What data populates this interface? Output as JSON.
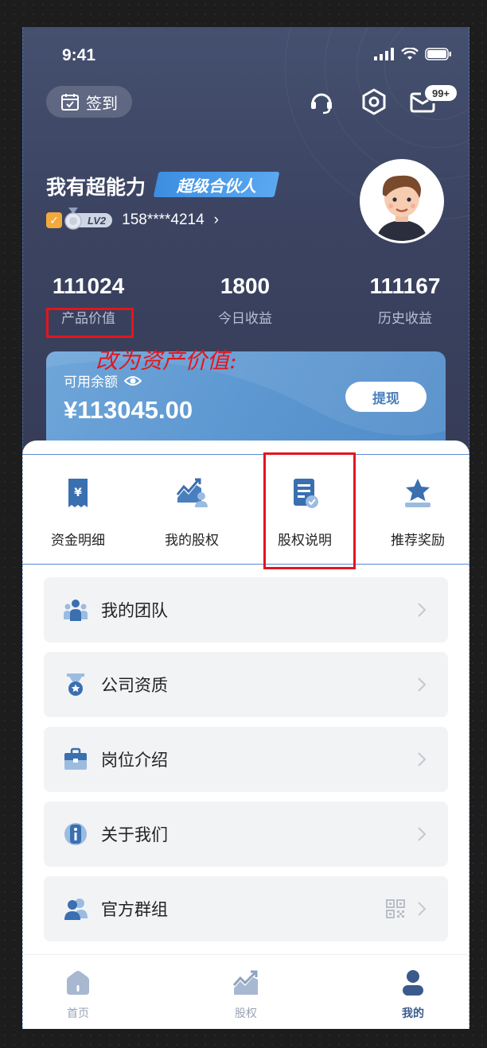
{
  "status": {
    "time": "9:41"
  },
  "header": {
    "checkin_label": "签到",
    "message_badge": "99+",
    "username": "我有超能力",
    "partner_badge": "超级合伙人",
    "level": "LV2",
    "phone": "158****4214",
    "phone_chevron": "›"
  },
  "stats": [
    {
      "value": "111024",
      "label": "产品价值"
    },
    {
      "value": "1800",
      "label": "今日收益"
    },
    {
      "value": "111167",
      "label": "历史收益"
    }
  ],
  "annotation": {
    "text": "改为资产价值:",
    "color": "#e4151c"
  },
  "balance": {
    "label": "可用余额",
    "amount": "¥113045.00",
    "withdraw_label": "提现"
  },
  "quick_actions": [
    {
      "label": "资金明细",
      "icon": "receipt-yen-icon"
    },
    {
      "label": "我的股权",
      "icon": "equity-chart-icon"
    },
    {
      "label": "股权说明",
      "icon": "document-check-icon"
    },
    {
      "label": "推荐奖励",
      "icon": "award-star-icon"
    }
  ],
  "menu": [
    {
      "label": "我的团队",
      "icon": "team-icon"
    },
    {
      "label": "公司资质",
      "icon": "medal-icon"
    },
    {
      "label": "岗位介绍",
      "icon": "briefcase-icon"
    },
    {
      "label": "关于我们",
      "icon": "info-icon"
    },
    {
      "label": "官方群组",
      "icon": "group-icon"
    }
  ],
  "tabbar": [
    {
      "label": "首页",
      "icon": "home-icon",
      "active": false
    },
    {
      "label": "股权",
      "icon": "chart-icon",
      "active": false
    },
    {
      "label": "我的",
      "icon": "profile-icon",
      "active": true
    }
  ],
  "colors": {
    "header_bg": "#3b4361",
    "accent_blue": "#5b96d0",
    "annotation_red": "#e4151c",
    "active_tab": "#3b5a8c"
  }
}
